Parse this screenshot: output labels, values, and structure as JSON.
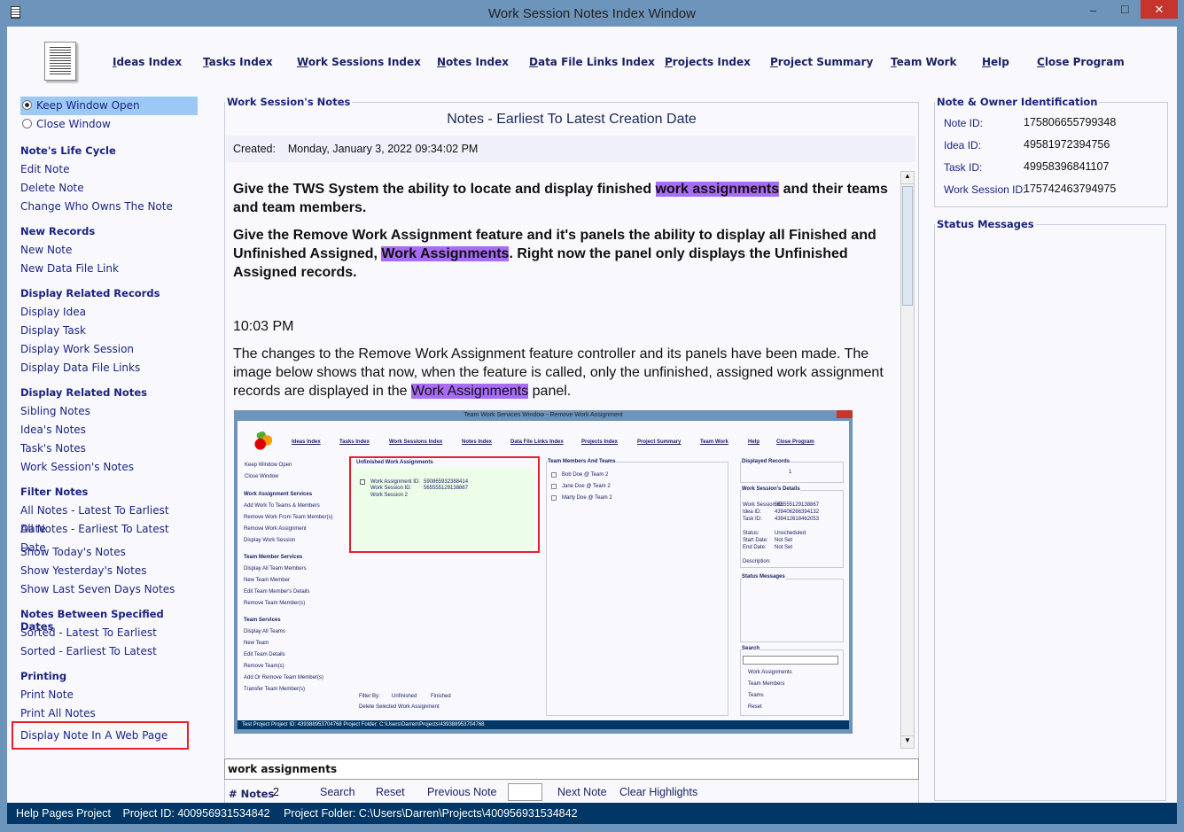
{
  "window": {
    "title": "Work Session Notes Index Window",
    "minimize": "‒",
    "maximize": "□",
    "close": "✕"
  },
  "nav": [
    "Ideas Index",
    "Tasks Index",
    "Work Sessions Index",
    "Notes Index",
    "Data File Links Index",
    "Projects Index",
    "Project Summary",
    "Team Work",
    "Help",
    "Close Program"
  ],
  "sidebar": {
    "radios": [
      {
        "label": "Keep Window Open",
        "selected": true
      },
      {
        "label": "Close Window",
        "selected": false
      }
    ],
    "groups": [
      {
        "header": "Note's Life Cycle",
        "items": [
          "Edit Note",
          "Delete Note",
          "Change Who Owns The Note"
        ]
      },
      {
        "header": "New Records",
        "items": [
          "New Note",
          "New Data File Link"
        ]
      },
      {
        "header": "Display Related Records",
        "items": [
          "Display Idea",
          "Display Task",
          "Display Work Session",
          "Display Data File Links"
        ]
      },
      {
        "header": "Display Related Notes",
        "items": [
          "Sibling Notes",
          "Idea's Notes",
          "Task's Notes",
          "Work Session's Notes"
        ]
      },
      {
        "header": "Filter Notes",
        "items": [
          "All Notes - Latest To Earliest Date",
          "All Notes - Earliest To Latest Date"
        ]
      },
      {
        "header": "",
        "items": [
          "Show Today's Notes",
          "Show Yesterday's Notes",
          "Show Last Seven Days Notes"
        ]
      },
      {
        "header": "Notes Between Specified Dates",
        "items": [
          "Sorted - Latest To Earliest",
          "Sorted - Earliest To Latest"
        ]
      },
      {
        "header": "Printing",
        "items": [
          "Print Note",
          "Print All Notes",
          "Display Note In A Web Page"
        ]
      }
    ]
  },
  "notes_panel": {
    "legend": "Work Session's Notes",
    "title": "Notes - Earliest To Latest Creation Date",
    "created_label": "Created:",
    "created_value": "Monday, January 3, 2022   09:34:02 PM"
  },
  "note": {
    "p1a": "Give the TWS System the ability to locate and display finished ",
    "p1h": "work assignments",
    "p1b": " and their teams and team members.",
    "p2a": "Give the Remove Work Assignment feature and it's panels the ability to display all Finished and Unfinished Assigned,  ",
    "p2h": "Work Assignments",
    "p2b": ". Right now the panel only displays the Unfinished Assigned records.",
    "time": "10:03 PM",
    "p3a": "The changes to the Remove Work Assignment feature controller and its panels have been made. The image below shows that now, when the feature is called, only the unfinished, assigned work assignment records are displayed in the ",
    "p3h": "Work Assignments",
    "p3b": " panel.",
    "highlight_color": "#a96cf7"
  },
  "embedded_image": {
    "title": "Team Work Services Window - Remove Work Assignment",
    "nav": [
      "Ideas Index",
      "Tasks Index",
      "Work Sessions Index",
      "Notes Index",
      "Data File Links Index",
      "Projects Index",
      "Project Summary",
      "Team Work",
      "Help",
      "Close Program"
    ],
    "radios": [
      "Keep Window Open",
      "Close Window"
    ],
    "side": [
      [
        "Work Assignment Services",
        "Add Work To Teams & Members",
        "Remove Work From Team Member(s)",
        "Remove Work Assignment",
        "Display Work Session"
      ],
      [
        "Team Member Services",
        "Display All Team Members",
        "New Team Member",
        "Edit Team Member's Details",
        "Remove Team Member(s)"
      ],
      [
        "Team Services",
        "Display All Teams",
        "New Team",
        "Edit Team Details",
        "Remove Team(s)",
        "Add Or Remove Team Member(s)",
        "Transfer Team Member(s)"
      ]
    ],
    "unfinished_legend": "Unfinished Work Assignments",
    "assignment": [
      "Work Assignment ID:",
      "590865932388414",
      "Work Session ID:",
      "565555129138867",
      "Work Session 2"
    ],
    "filter_by": "Filter By:",
    "unfinished": "Unfinished",
    "finished": "Finished",
    "delete": "Delete Selected Work Assignment",
    "members_legend": "Team Members And Teams",
    "members": [
      "Bob Doe @ Team 2",
      "Jane Doe @ Team 2",
      "Marty Doe @ Team 2"
    ],
    "displayed_legend": "Displayed Records",
    "displayed": "1",
    "details_legend": "Work Session's Details",
    "details": [
      [
        "Work Session ID:",
        "565555129138867"
      ],
      [
        "Idea ID:",
        "439406266394132"
      ],
      [
        "Task ID:",
        "439412618462053"
      ],
      [
        "Status:",
        "Unscheduled"
      ],
      [
        "Start Date:",
        "Not Set"
      ],
      [
        "End Date:",
        "Not Set"
      ],
      [
        "Description:",
        ""
      ]
    ],
    "status_legend": "Status Messages",
    "search_legend": "Search",
    "search_opts": [
      "Work Assignments",
      "Team Members",
      "Teams",
      "Reset"
    ],
    "statusbar": "Test Project    Project ID: 439388953704768    Project Folder: C:\\Users\\Darren\\Projects\\439388953704768"
  },
  "owner": {
    "legend": "Note & Owner Identification",
    "rows": [
      [
        "Note ID:",
        "175806655799348"
      ],
      [
        "Idea ID:",
        "49581972394756"
      ],
      [
        "Task ID:",
        "49958396841107"
      ],
      [
        "Work Session ID:",
        "175742463794975"
      ]
    ]
  },
  "status_messages": {
    "legend": "Status Messages"
  },
  "search": {
    "value": "work assignments"
  },
  "bottom": {
    "count_label": "# Notes",
    "count": "2",
    "search": "Search",
    "reset": "Reset",
    "previous": "Previous Note",
    "note_number": "",
    "next": "Next Note",
    "clear": "Clear Highlights"
  },
  "statusbar": {
    "project": "Help Pages Project",
    "project_id": "Project ID:  400956931534842",
    "folder": "Project Folder: C:\\Users\\Darren\\Projects\\400956931534842"
  }
}
